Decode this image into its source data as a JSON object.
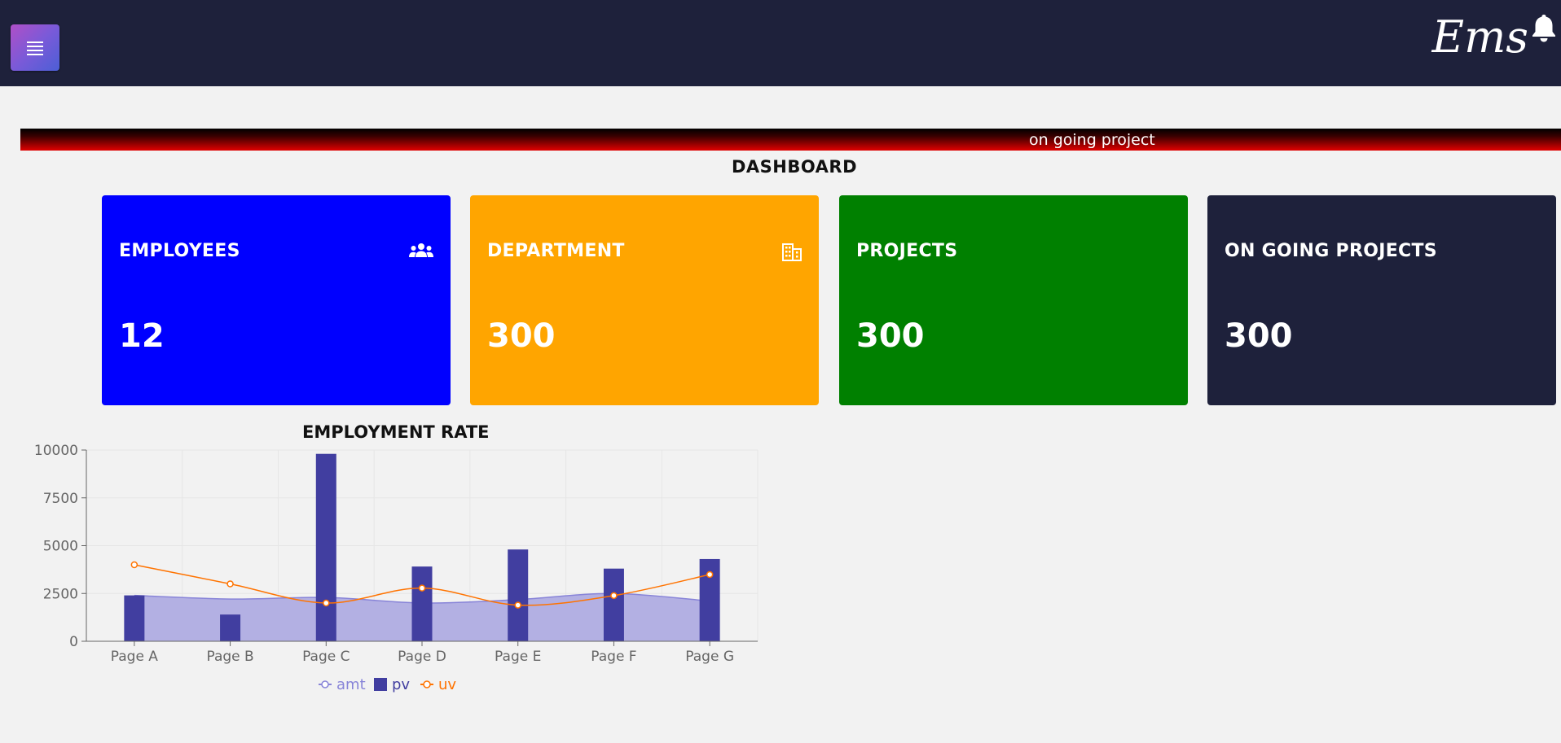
{
  "header": {
    "brand": "Ems",
    "menu_icon": "hamburger-menu-icon",
    "bell_icon": "bell-icon"
  },
  "marquee": {
    "text": "on going project"
  },
  "page": {
    "title": "DASHBOARD"
  },
  "cards": [
    {
      "label": "EMPLOYEES",
      "value": "12",
      "icon": "users-icon",
      "color": "#0000ff"
    },
    {
      "label": "DEPARTMENT",
      "value": "300",
      "icon": "building-icon",
      "color": "#ffa500"
    },
    {
      "label": "PROJECTS",
      "value": "300",
      "icon": "",
      "color": "#008000"
    },
    {
      "label": "ON GOING PROJECTS",
      "value": "300",
      "icon": "",
      "color": "#1e213b"
    }
  ],
  "chart": {
    "title": "EMPLOYMENT RATE"
  },
  "colors": {
    "topbar": "#1e213b",
    "pv": "#413ea0",
    "amt_fill": "#b3b0e3",
    "amt_line": "#8884d8",
    "uv": "#ff7300"
  },
  "chart_data": {
    "type": "bar",
    "categories": [
      "Page A",
      "Page B",
      "Page C",
      "Page D",
      "Page E",
      "Page F",
      "Page G"
    ],
    "series": [
      {
        "name": "amt",
        "type": "area",
        "values": [
          2400,
          2210,
          2290,
          2000,
          2181,
          2500,
          2100
        ]
      },
      {
        "name": "pv",
        "type": "bar",
        "values": [
          2400,
          1398,
          9800,
          3908,
          4800,
          3800,
          4300
        ]
      },
      {
        "name": "uv",
        "type": "line",
        "values": [
          4000,
          3000,
          2000,
          2780,
          1890,
          2390,
          3490
        ]
      }
    ],
    "yticks": [
      0,
      2500,
      5000,
      7500,
      10000
    ],
    "ylim": [
      0,
      10000
    ],
    "grid": true,
    "legend": "bottom-center",
    "legend_order": [
      "amt",
      "pv",
      "uv"
    ]
  }
}
